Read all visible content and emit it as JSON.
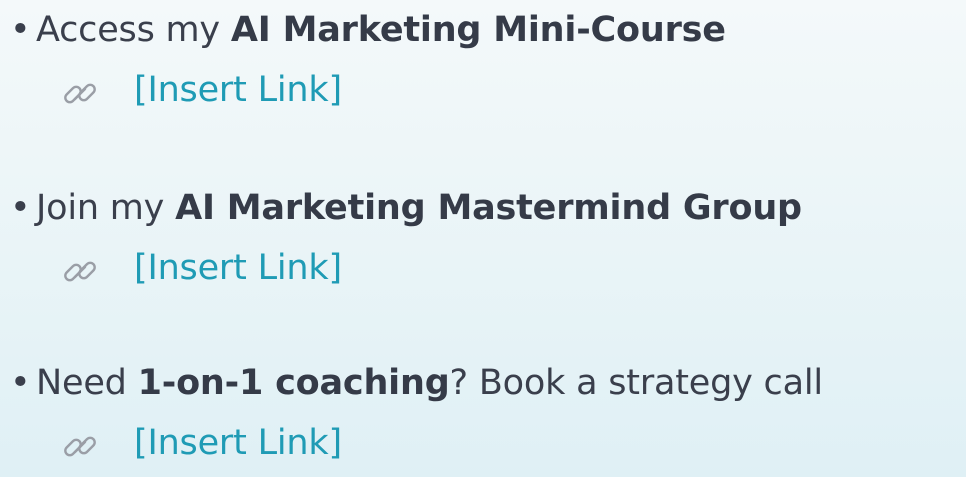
{
  "items": [
    {
      "prefix": "Access my ",
      "bold": "AI Marketing Mini-Course",
      "suffix": "",
      "link_label": "[Insert Link]",
      "link_icon": "link-icon"
    },
    {
      "prefix": "Join my ",
      "bold": "AI Marketing Mastermind Group",
      "suffix": "",
      "link_label": "[Insert Link]",
      "link_icon": "link-icon"
    },
    {
      "prefix": "Need ",
      "bold": "1-on-1 coaching",
      "suffix": "? Book a strategy call",
      "link_label": "[Insert Link]",
      "link_icon": "link-icon"
    }
  ],
  "bullet": "•",
  "colors": {
    "text": "#3a3f4c",
    "link": "#1f9bb5",
    "icon": "#9a9ea6"
  }
}
